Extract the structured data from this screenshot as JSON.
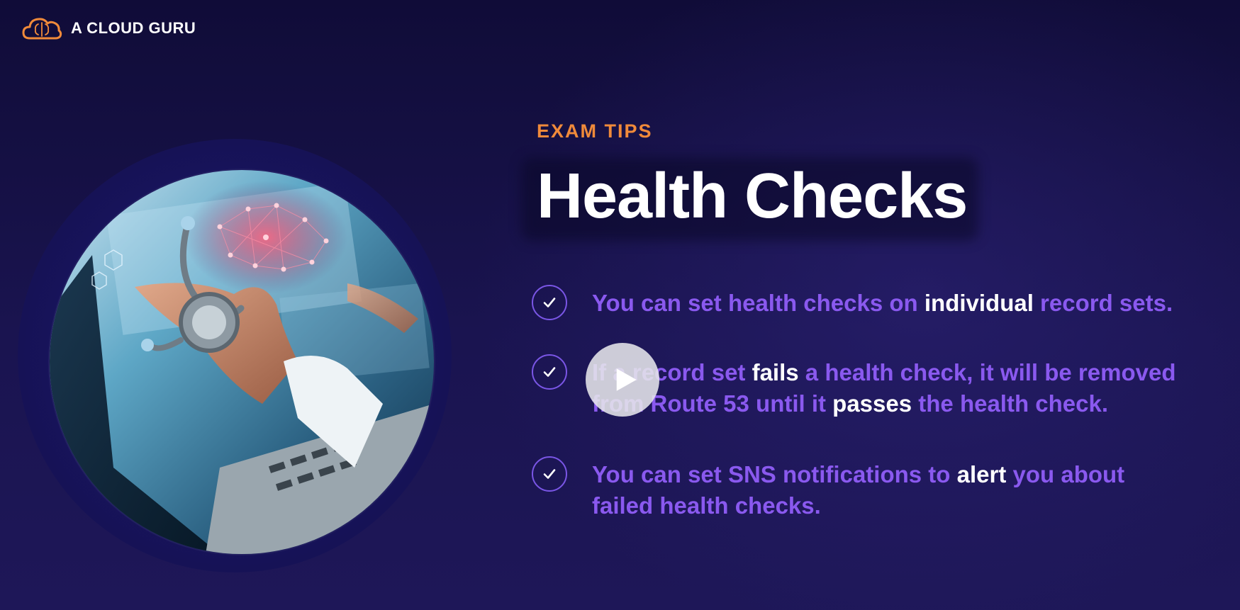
{
  "brand": {
    "name": "A CLOUD GURU",
    "logo_icon": "cloud-brain-icon",
    "accent": "#f08a3a"
  },
  "slide": {
    "eyebrow": "EXAM TIPS",
    "title": "Health Checks",
    "image_alt_icon": "doctor-stethoscope-laptop-image",
    "tips": [
      {
        "icon": "check-circle-icon",
        "parts": [
          "You can set health checks on ",
          "individual",
          " record sets."
        ]
      },
      {
        "icon": "check-circle-icon",
        "line1": [
          "If a record set ",
          "fails",
          " a health check, it will be removed"
        ],
        "line2": [
          "from Route 53 until it ",
          "passes",
          " the health check."
        ]
      },
      {
        "icon": "check-circle-icon",
        "line1": [
          "You can set SNS notifications to ",
          "alert",
          " you about"
        ],
        "line2": [
          "failed health checks."
        ]
      }
    ],
    "colors": {
      "tip_text": "#8a59ef",
      "highlight": "#ffffff",
      "title": "#ffffff"
    }
  },
  "player": {
    "play_icon": "play-icon"
  }
}
